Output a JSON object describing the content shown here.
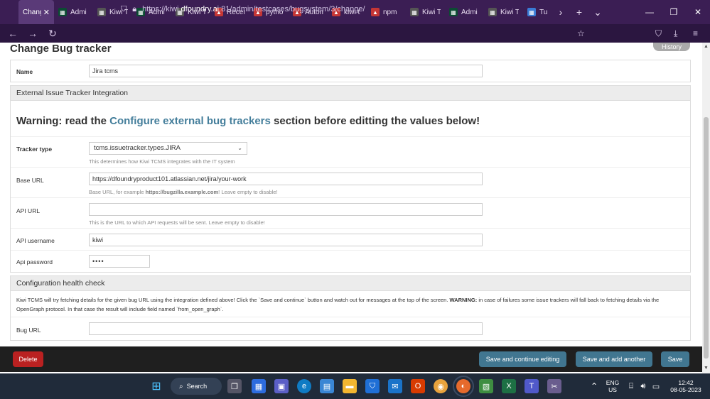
{
  "browser": {
    "tabs": [
      {
        "label": "Change",
        "active": true
      },
      {
        "label": "Admi"
      },
      {
        "label": "Kiwi T"
      },
      {
        "label": "Admi"
      },
      {
        "label": "Kiwi T"
      },
      {
        "label": "Recen"
      },
      {
        "label": "pytho"
      },
      {
        "label": "Autom"
      },
      {
        "label": "kiwi t"
      },
      {
        "label": "npm"
      },
      {
        "label": "Kiwi T"
      },
      {
        "label": "Admi"
      },
      {
        "label": "Kiwi T"
      },
      {
        "label": "Tuto"
      }
    ],
    "url_prefix": "https://kiwi.",
    "url_host": "dfoundry.ai",
    "url_suffix": ":81/admin/testcases/bugsystem/3/change/"
  },
  "page": {
    "title": "Change Bug tracker",
    "history_label": "History",
    "name": {
      "label": "Name",
      "value": "Jira tcms"
    },
    "integration": {
      "header": "External Issue Tracker Integration",
      "warning_prefix": "Warning: read the ",
      "warning_link": "Configure external bug trackers",
      "warning_suffix": " section before editting the values below!",
      "tracker_type": {
        "label": "Tracker type",
        "value": "tcms.issuetracker.types.JIRA",
        "help": "This determines how Kiwi TCMS integrates with the IT system"
      },
      "base_url": {
        "label": "Base URL",
        "value": "https://dfoundryproduct101.atlassian.net/jira/your-work",
        "help_prefix": "Base URL, for example ",
        "help_example": "https://bugzilla.example.com",
        "help_suffix": "! Leave empty to disable!"
      },
      "api_url": {
        "label": "API URL",
        "value": "",
        "help": "This is the URL to which API requests will be sent. Leave empty to disable!"
      },
      "api_username": {
        "label": "API username",
        "value": "kiwi"
      },
      "api_password": {
        "label": "Api password",
        "value": "••••"
      }
    },
    "health": {
      "header": "Configuration health check",
      "text_part1": "Kiwi TCMS will try fetching details for the given bug URL using the integration defined above! Click the `Save and continue` button and watch out for messages at the top of the screen. ",
      "text_bold": "WARNING:",
      "text_part2": " in case of failures some issue trackers will fall back to fetching details via the OpenGraph protocol. In that case the result will include field named `from_open_graph`.",
      "bug_url": {
        "label": "Bug URL",
        "value": ""
      }
    },
    "buttons": {
      "delete": "Delete",
      "save_continue": "Save and continue editing",
      "save_add": "Save and add another",
      "save": "Save"
    }
  },
  "taskbar": {
    "search_label": "Search",
    "lang_top": "ENG",
    "lang_bottom": "US",
    "time": "12:42",
    "date": "08-05-2023"
  },
  "colors": {
    "browser_chrome": "#3b1e54",
    "link": "#447e9b",
    "delete": "#ba2121",
    "button_blue": "#417690",
    "taskbar": "#202b3a"
  }
}
